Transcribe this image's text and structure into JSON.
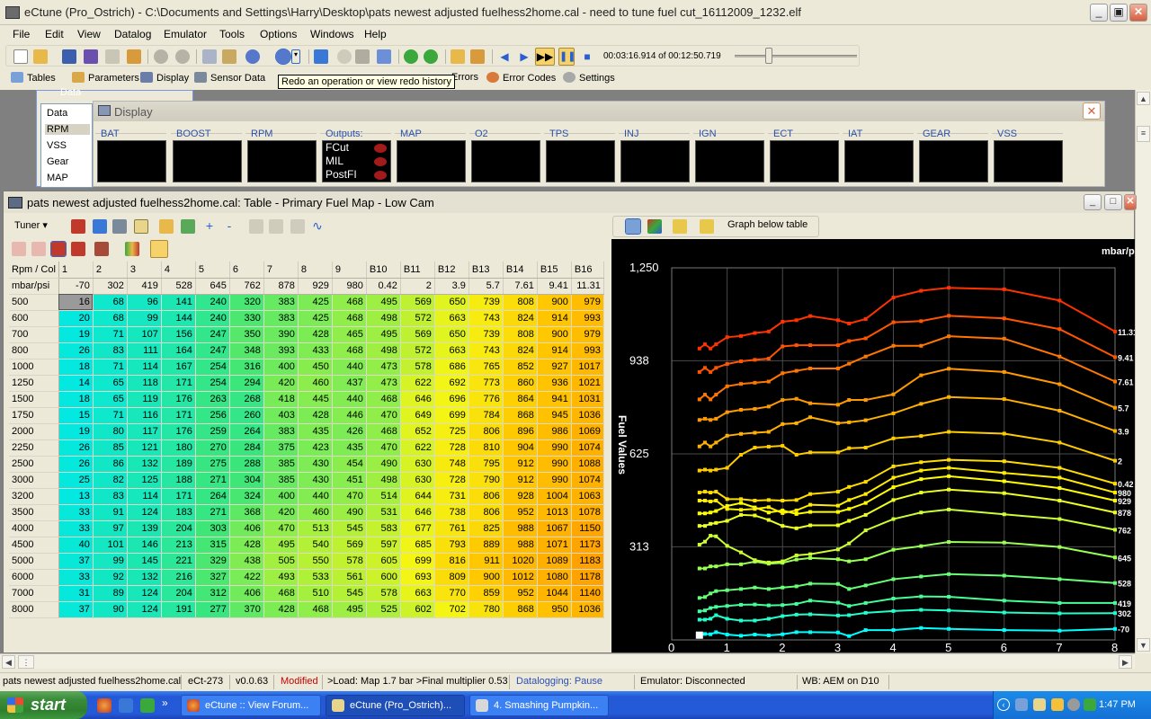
{
  "window": {
    "title": "eCtune (Pro_Ostrich) - C:\\Documents and Settings\\Harry\\Desktop\\pats newest adjusted fuelhess2home.cal - need to tune fuel cut_16112009_1232.elf"
  },
  "menu": [
    "File",
    "Edit",
    "View",
    "Datalog",
    "Emulator",
    "Tools",
    "Options",
    "Windows",
    "Help"
  ],
  "playback": {
    "time": "00:03:16.914 of 00:12:50.719",
    "position_fraction": 0.27
  },
  "toolbar2": {
    "tables": "Tables",
    "parameters": "Parameters",
    "display": "Display",
    "sensor_data": "Sensor Data",
    "errors": "Errors",
    "error_codes": "Error Codes",
    "settings": "Settings"
  },
  "tooltip": "Redo an operation or view redo history",
  "data_window": {
    "title": "Data",
    "header": "Data",
    "items": [
      "RPM",
      "VSS",
      "Gear",
      "MAP"
    ]
  },
  "display_window": {
    "title": "Display",
    "gauges": [
      "BAT",
      "BOOST",
      "RPM",
      "Outputs:",
      "MAP",
      "O2",
      "TPS",
      "INJ",
      "IGN",
      "ECT",
      "IAT",
      "GEAR",
      "VSS"
    ],
    "outputs": [
      "FCut",
      "MIL",
      "PostFI"
    ]
  },
  "table_window": {
    "title": "pats newest adjusted fuelhess2home.cal: Table - Primary Fuel Map - Low Cam",
    "tuner_label": "Tuner",
    "corner_rpm": "Rpm / Col",
    "corner_map": "mbar/psi",
    "col_headers": [
      "1",
      "2",
      "3",
      "4",
      "5",
      "6",
      "7",
      "8",
      "9",
      "B10",
      "B11",
      "B12",
      "B13",
      "B14",
      "B15",
      "B16"
    ],
    "map_values": [
      "-70",
      "302",
      "419",
      "528",
      "645",
      "762",
      "878",
      "929",
      "980",
      "0.42",
      "2",
      "3.9",
      "5.7",
      "7.61",
      "9.41",
      "11.31"
    ],
    "rows": [
      {
        "rpm": "500",
        "values": [
          16,
          68,
          96,
          141,
          240,
          320,
          383,
          425,
          468,
          495,
          569,
          650,
          739,
          808,
          900,
          979
        ]
      },
      {
        "rpm": "600",
        "values": [
          20,
          68,
          99,
          144,
          240,
          330,
          383,
          425,
          468,
          498,
          572,
          663,
          743,
          824,
          914,
          993
        ]
      },
      {
        "rpm": "700",
        "values": [
          19,
          71,
          107,
          156,
          247,
          350,
          390,
          428,
          465,
          495,
          569,
          650,
          739,
          808,
          900,
          979
        ]
      },
      {
        "rpm": "800",
        "values": [
          26,
          83,
          111,
          164,
          247,
          348,
          393,
          433,
          468,
          498,
          572,
          663,
          743,
          824,
          914,
          993
        ]
      },
      {
        "rpm": "1000",
        "values": [
          18,
          71,
          114,
          167,
          254,
          316,
          400,
          450,
          440,
          473,
          578,
          686,
          765,
          852,
          927,
          1017
        ]
      },
      {
        "rpm": "1250",
        "values": [
          14,
          65,
          118,
          171,
          254,
          294,
          420,
          460,
          437,
          473,
          622,
          692,
          773,
          860,
          936,
          1021
        ]
      },
      {
        "rpm": "1500",
        "values": [
          18,
          65,
          119,
          176,
          263,
          268,
          418,
          445,
          440,
          468,
          646,
          696,
          776,
          864,
          941,
          1031
        ]
      },
      {
        "rpm": "1750",
        "values": [
          15,
          71,
          116,
          171,
          256,
          260,
          403,
          428,
          446,
          470,
          649,
          699,
          784,
          868,
          945,
          1036
        ]
      },
      {
        "rpm": "2000",
        "values": [
          19,
          80,
          117,
          176,
          259,
          264,
          383,
          435,
          426,
          468,
          652,
          725,
          806,
          896,
          986,
          1069
        ]
      },
      {
        "rpm": "2250",
        "values": [
          26,
          85,
          121,
          180,
          270,
          284,
          375,
          423,
          435,
          470,
          622,
          728,
          810,
          904,
          990,
          1074
        ]
      },
      {
        "rpm": "2500",
        "values": [
          26,
          86,
          132,
          189,
          275,
          288,
          385,
          430,
          454,
          490,
          630,
          748,
          795,
          912,
          990,
          1088
        ]
      },
      {
        "rpm": "3000",
        "values": [
          25,
          82,
          125,
          188,
          271,
          304,
          385,
          430,
          451,
          498,
          630,
          728,
          790,
          912,
          990,
          1074
        ]
      },
      {
        "rpm": "3200",
        "values": [
          13,
          83,
          114,
          171,
          264,
          324,
          400,
          440,
          470,
          514,
          644,
          731,
          806,
          928,
          1004,
          1063
        ]
      },
      {
        "rpm": "3500",
        "values": [
          33,
          91,
          124,
          183,
          271,
          368,
          420,
          460,
          490,
          531,
          646,
          738,
          806,
          952,
          1013,
          1078
        ]
      },
      {
        "rpm": "4000",
        "values": [
          33,
          97,
          139,
          204,
          303,
          406,
          470,
          513,
          545,
          583,
          677,
          761,
          825,
          988,
          1067,
          1150
        ]
      },
      {
        "rpm": "4500",
        "values": [
          40,
          101,
          146,
          213,
          315,
          428,
          495,
          540,
          569,
          597,
          685,
          793,
          889,
          988,
          1071,
          1173
        ]
      },
      {
        "rpm": "5000",
        "values": [
          37,
          99,
          145,
          221,
          329,
          438,
          505,
          550,
          578,
          605,
          699,
          816,
          911,
          1020,
          1089,
          1183
        ]
      },
      {
        "rpm": "6000",
        "values": [
          33,
          92,
          132,
          216,
          327,
          422,
          493,
          533,
          561,
          600,
          693,
          809,
          900,
          1012,
          1080,
          1178
        ]
      },
      {
        "rpm": "7000",
        "values": [
          31,
          89,
          124,
          204,
          312,
          406,
          468,
          510,
          545,
          578,
          663,
          770,
          859,
          952,
          1044,
          1140
        ]
      },
      {
        "rpm": "8000",
        "values": [
          37,
          90,
          124,
          191,
          277,
          370,
          428,
          468,
          495,
          525,
          602,
          702,
          780,
          868,
          950,
          1036
        ]
      }
    ]
  },
  "graph": {
    "toolbar_label": "Graph below table",
    "y_axis_label": "Fuel Values",
    "units_label": "mbar/psi",
    "y_ticks": [
      "1,250",
      "938",
      "625",
      "313"
    ],
    "x_ticks": [
      "0",
      "1",
      "2",
      "3",
      "4",
      "5",
      "6",
      "7",
      "8"
    ],
    "series_labels": [
      "11.31",
      "9.41",
      "7.61",
      "5.7",
      "3.9",
      "2",
      "0.42",
      "980",
      "929",
      "878",
      "762",
      "645",
      "528",
      "419",
      "302",
      "-70"
    ]
  },
  "chart_data": {
    "type": "line",
    "ylabel": "Fuel Values",
    "x": [
      0.5,
      0.6,
      0.7,
      0.8,
      1.0,
      1.25,
      1.5,
      1.75,
      2.0,
      2.25,
      2.5,
      3.0,
      3.2,
      3.5,
      4.0,
      4.5,
      5.0,
      6.0,
      7.0,
      8.0
    ],
    "series_from": "table_window.rows",
    "ylim": [
      0,
      1250
    ],
    "xlim": [
      0,
      8
    ],
    "colors": [
      "#00ffff",
      "#22ffcc",
      "#44ff99",
      "#66ff77",
      "#99ff55",
      "#ccff33",
      "#eeff22",
      "#ffff00",
      "#ffee00",
      "#ffdd00",
      "#ffcc00",
      "#ffb000",
      "#ff9900",
      "#ff7700",
      "#ff5500",
      "#ff3300"
    ]
  },
  "statusbar": {
    "file": "pats newest adjusted fuelhess2home.cal",
    "ecu": "eCt-273",
    "version": "v0.0.63",
    "state": "Modified",
    "load": ">Load: Map 1.7 bar  >Final multiplier 0.53",
    "datalogging": "Datalogging: Pause",
    "emulator": "Emulator: Disconnected",
    "wb": "WB: AEM on D10"
  },
  "taskbar": {
    "start": "start",
    "tasks": [
      "eCtune :: View Forum...",
      "eCtune (Pro_Ostrich)...",
      "4. Smashing Pumpkin..."
    ],
    "clock": "1:47 PM"
  }
}
